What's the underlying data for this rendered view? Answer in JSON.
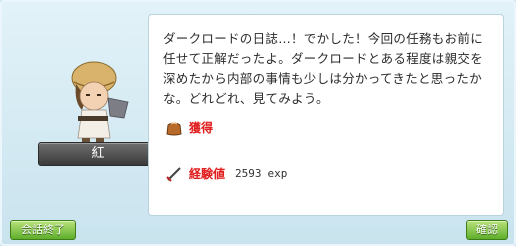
{
  "npc": {
    "name": "紅"
  },
  "message": {
    "text": "ダークロードの日誌…！でかした！今回の任務もお前に任せて正解だったよ。ダークロードとある程度は親交を深めたから内部の事情も少しは分かってきたと思ったかな。どれどれ、見てみよう。"
  },
  "rewards": {
    "item_label": "獲得",
    "item_icon": "bag-icon",
    "exp_label": "経験値",
    "exp_icon": "sword-icon",
    "exp_value": "2593",
    "exp_unit": "exp"
  },
  "buttons": {
    "end_chat": "会話終了",
    "confirm": "確認"
  }
}
